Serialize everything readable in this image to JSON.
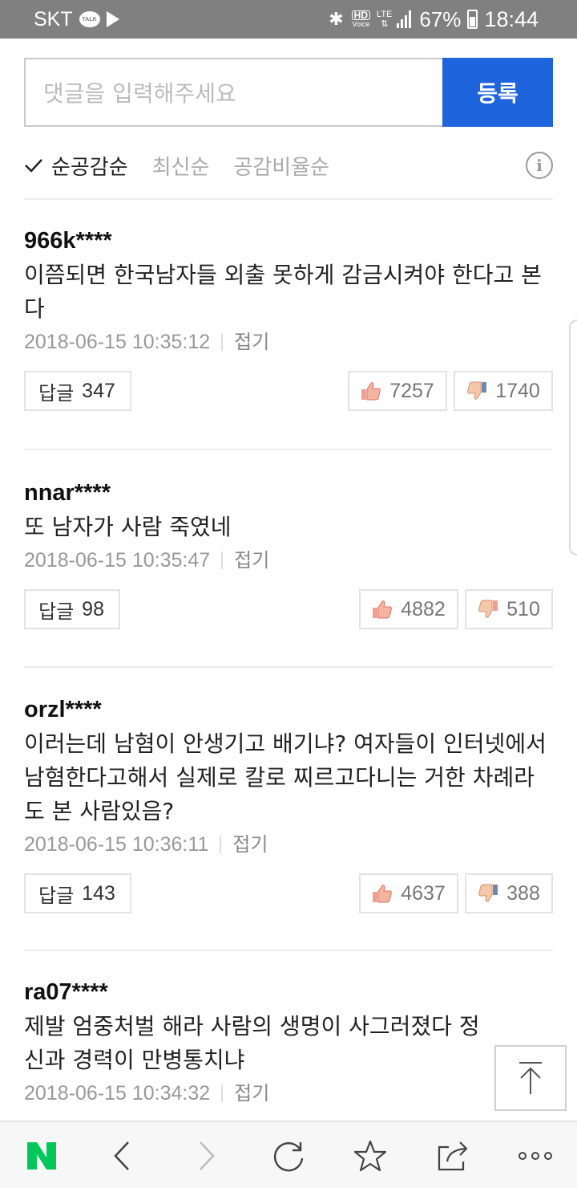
{
  "status_bar": {
    "carrier": "SKT",
    "talk_badge": "TALK",
    "hd_label": "HD",
    "voice_label": "Voice",
    "lte_label": "LTE",
    "battery": "67%",
    "time": "18:44"
  },
  "comment_input": {
    "placeholder": "댓글을 입력해주세요",
    "submit_label": "등록"
  },
  "sort": {
    "active": "순공감순",
    "options": [
      "최신순",
      "공감비율순"
    ],
    "info_icon": "info-icon"
  },
  "comments": [
    {
      "user": "966k****",
      "text": "이쯤되면 한국남자들 외출 못하게 감금시켜야 한다고 본다",
      "timestamp": "2018-06-15 10:35:12",
      "fold_label": "접기",
      "reply_label": "답글",
      "reply_count": "347",
      "likes": "7257",
      "dislikes": "1740"
    },
    {
      "user": "nnar****",
      "text": "또 남자가 사람 죽였네",
      "timestamp": "2018-06-15 10:35:47",
      "fold_label": "접기",
      "reply_label": "답글",
      "reply_count": "98",
      "likes": "4882",
      "dislikes": "510"
    },
    {
      "user": "orzl****",
      "text": "이러는데 남혐이 안생기고 배기냐? 여자들이 인터넷에서 남혐한다고해서 실제로 칼로 찌르고다니는 거한 차례라도 본 사람있음?",
      "timestamp": "2018-06-15 10:36:11",
      "fold_label": "접기",
      "reply_label": "답글",
      "reply_count": "143",
      "likes": "4637",
      "dislikes": "388"
    },
    {
      "user": "ra07****",
      "text": "제발 엄중처벌 해라 사람의 생명이 사그러졌다 정신과 경력이 만병통치냐",
      "timestamp": "2018-06-15 10:34:32",
      "fold_label": "접기"
    }
  ],
  "bottom_bar": {
    "items": [
      "naver-logo-icon",
      "back-icon",
      "forward-icon",
      "refresh-icon",
      "bookmark-star-icon",
      "share-icon",
      "more-icon"
    ],
    "logo_letter": "N",
    "colors": {
      "naver_green": "#03c75a",
      "accent_blue": "#1e64dc"
    }
  }
}
